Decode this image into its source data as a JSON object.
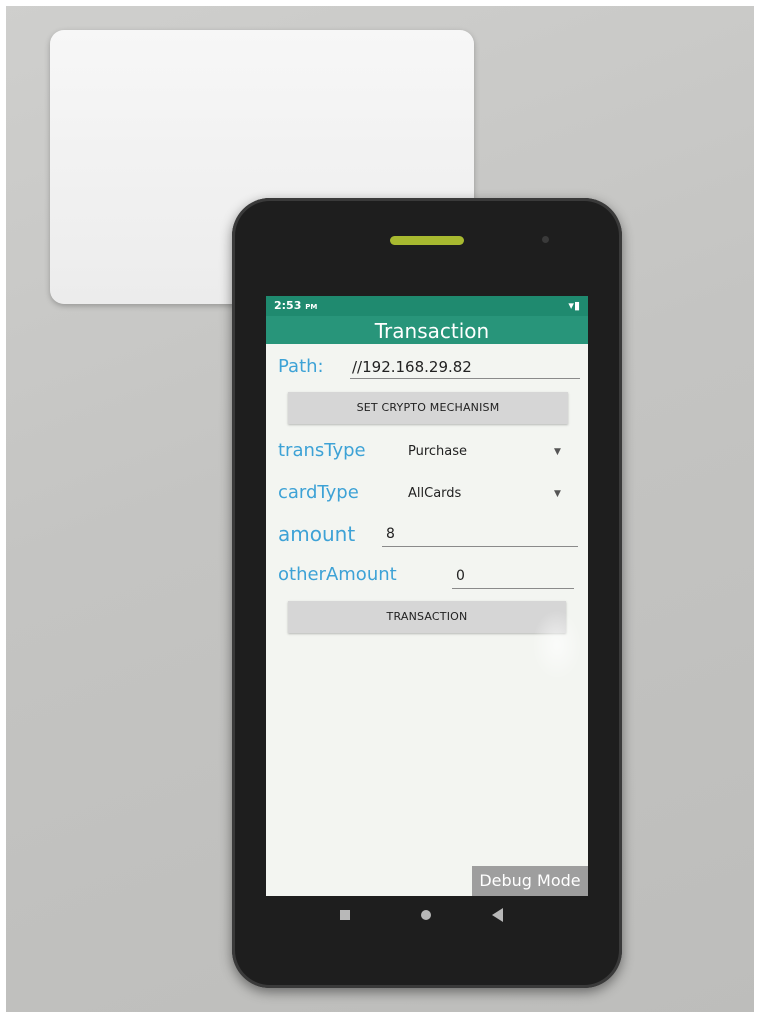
{
  "status": {
    "time": "2:53",
    "ampm": "PM",
    "icons": "▾▮"
  },
  "app": {
    "title": "Transaction"
  },
  "form": {
    "path_label": "Path:",
    "path_value": "//192.168.29.82",
    "crypto_button": "SET CRYPTO MECHANISM",
    "trans_type_label": "transType",
    "trans_type_value": "Purchase",
    "card_type_label": "cardType",
    "card_type_value": "AllCards",
    "amount_label": "amount",
    "amount_value": "8",
    "other_amount_label": "otherAmount",
    "other_amount_value": "0",
    "transaction_button": "TRANSACTION"
  },
  "debug": {
    "label": "Debug Mode"
  },
  "colors": {
    "statusbar": "#1f8a6f",
    "appbar": "#28957a",
    "label": "#3da2d6"
  },
  "icons": {
    "nav": [
      "square-icon",
      "circle-icon",
      "back-triangle-icon"
    ]
  }
}
